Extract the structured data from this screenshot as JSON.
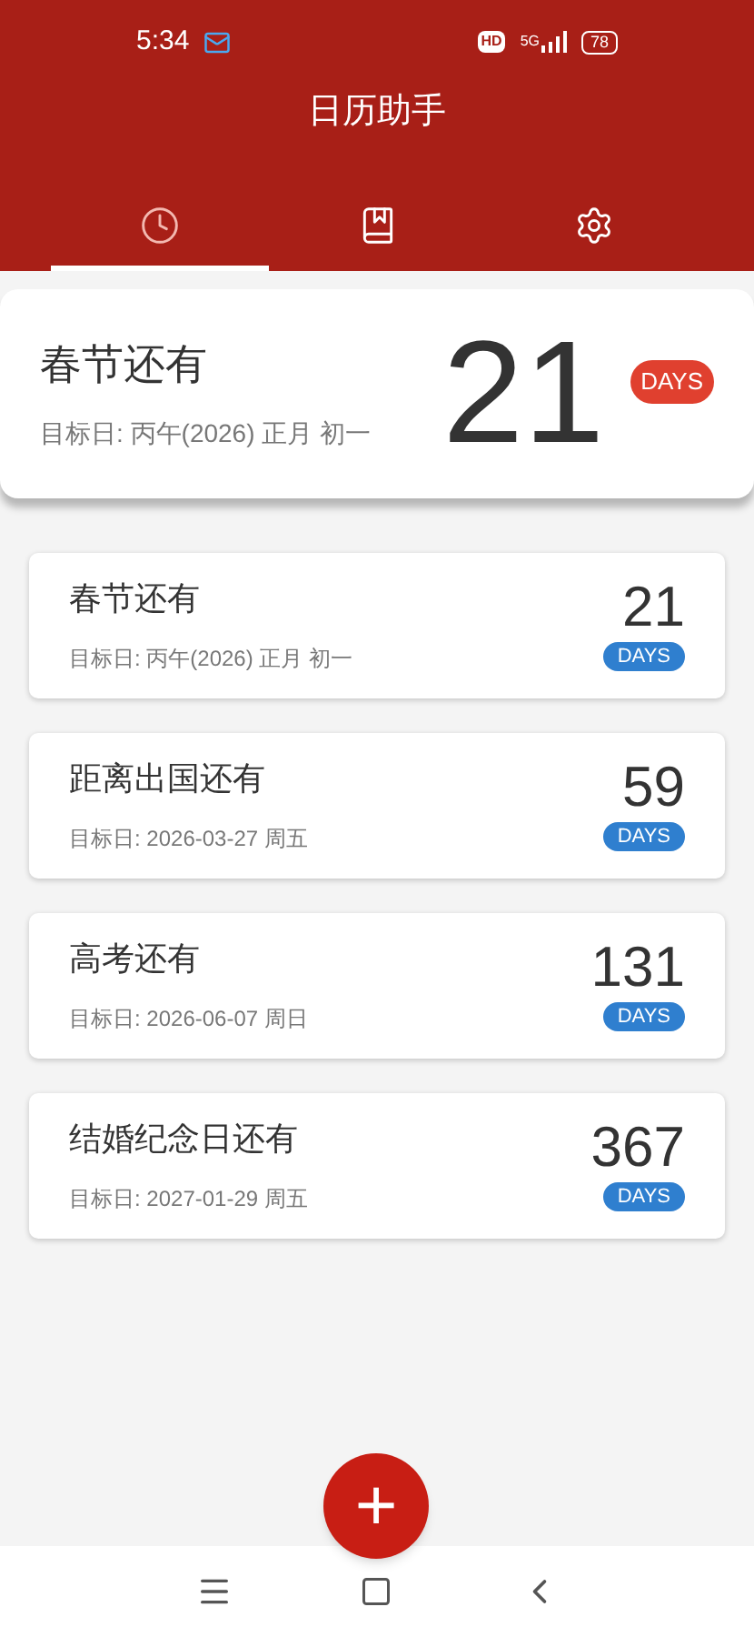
{
  "status_bar": {
    "time": "5:34",
    "hd": "HD",
    "network": "5G",
    "battery": "78"
  },
  "app_bar": {
    "title": "日历助手"
  },
  "tabs": [
    {
      "kind": "clock",
      "selected": true
    },
    {
      "kind": "bookmark",
      "selected": false
    },
    {
      "kind": "settings",
      "selected": false
    }
  ],
  "featured": {
    "title": "春节还有",
    "target": "目标日: 丙午(2026) 正月 初一",
    "count": "21",
    "unit": "DAYS"
  },
  "events": [
    {
      "title": "春节还有",
      "target": "目标日: 丙午(2026) 正月 初一",
      "count": "21",
      "unit": "DAYS"
    },
    {
      "title": "距离出国还有",
      "target": "目标日: 2026-03-27 周五",
      "count": "59",
      "unit": "DAYS"
    },
    {
      "title": "高考还有",
      "target": "目标日: 2026-06-07 周日",
      "count": "131",
      "unit": "DAYS"
    },
    {
      "title": "结婚纪念日还有",
      "target": "目标日: 2027-01-29 周五",
      "count": "367",
      "unit": "DAYS"
    }
  ],
  "fab": {
    "label": "+"
  }
}
